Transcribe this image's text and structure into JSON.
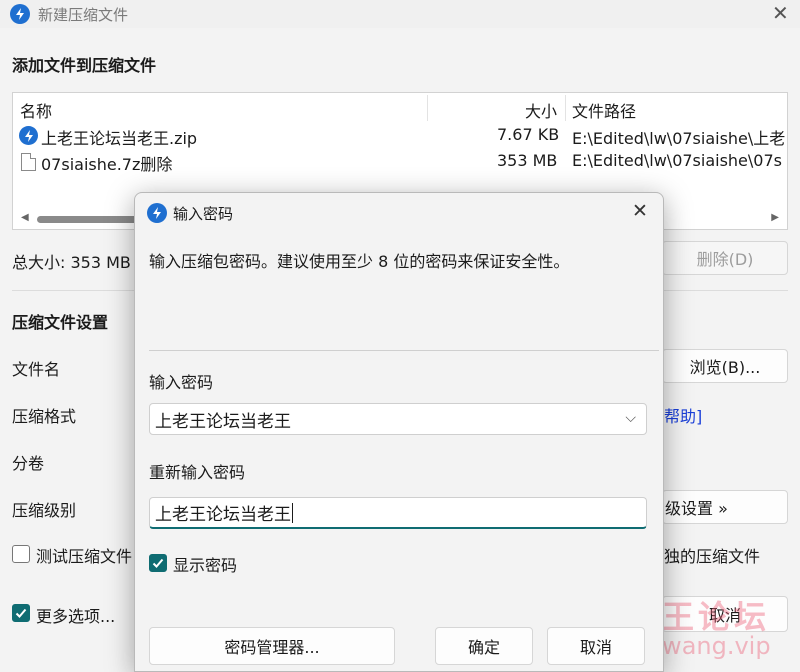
{
  "window": {
    "title": "新建压缩文件",
    "close_glyph": "✕"
  },
  "files_section": {
    "title": "添加文件到压缩文件",
    "columns": [
      "名称",
      "大小",
      "文件路径"
    ],
    "rows": [
      {
        "name": "上老王论坛当老王.zip",
        "size": "7.67 KB",
        "path": "E:\\Edited\\lw\\07siaishe\\上老",
        "icon": "app-archive-icon"
      },
      {
        "name": "07siaishe.7z删除",
        "size": "353 MB",
        "path": "E:\\Edited\\lw\\07siaishe\\07s",
        "icon": "file-icon"
      }
    ],
    "total_size": "总大小: 353 MB",
    "delete_button": "删除(D)"
  },
  "settings_section": {
    "title": "压缩文件设置",
    "filename_label": "文件名",
    "browse_button": "浏览(B)...",
    "format_label": "压缩格式",
    "help_link": "帮助]",
    "split_label": "分卷",
    "level_label": "压缩级别",
    "advanced_button": "级设置 »",
    "test_checkbox_label": "测试压缩文件",
    "separate_checkbox_label": "独的压缩文件",
    "more_options_label": "更多选项...",
    "cancel_button": "取消"
  },
  "watermark": {
    "cn": "老王论坛",
    "en": "laowang.vip"
  },
  "dialog": {
    "title": "输入密码",
    "close_glyph": "✕",
    "description": "输入压缩包密码。建议使用至少 8 位的密码来保证安全性。",
    "password_label": "输入密码",
    "password_value": "上老王论坛当老王",
    "confirm_label": "重新输入密码",
    "confirm_value": "上老王论坛当老王",
    "show_password_label": "显示密码",
    "show_password_checked": true,
    "manager_button": "密码管理器...",
    "ok_button": "确定",
    "cancel_button": "取消"
  },
  "colors": {
    "accent": "#0f6c72",
    "app_icon": "#1f6fd0",
    "link": "#1a3fd8"
  }
}
